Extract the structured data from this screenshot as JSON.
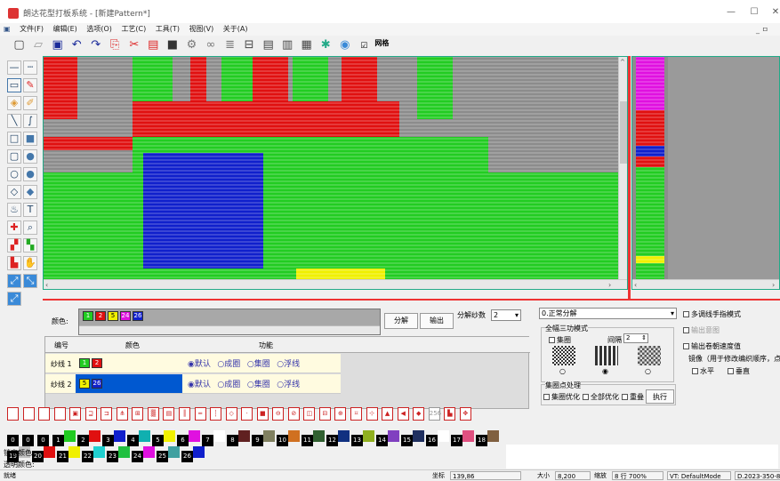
{
  "window": {
    "title": "朗达花型打板系统 - [新建Pattern*]",
    "controls": [
      "—",
      "☐",
      "✕"
    ]
  },
  "menu": {
    "doc_icon": "▣",
    "items": [
      "文件(F)",
      "编辑(E)",
      "选项(O)",
      "工艺(C)",
      "工具(T)",
      "视图(V)",
      "关于(A)"
    ],
    "mdi": "_ ㅁ"
  },
  "toolbar": {
    "grid_label": "网格",
    "icons": [
      "new-file-icon",
      "open-folder-icon",
      "save-icon",
      "undo-icon",
      "redo-icon",
      "copy-icon",
      "cut-icon",
      "paste-icon",
      "fill-icon",
      "gear-icon",
      "layers-icon",
      "stack-icon",
      "frame-icon",
      "list-icon",
      "bars-icon",
      "palette-icon",
      "settings-icon",
      "eye-icon"
    ]
  },
  "colors": {
    "green": "#22cc22",
    "red": "#e01010",
    "blue": "#1020cc",
    "gray": "#8c8c8c",
    "magenta": "#e010e0",
    "yellow": "#f0f000"
  },
  "yarn_panel": {
    "colors_label": "颜色:",
    "swatches": [
      {
        "num": "1",
        "color": "#22cc22"
      },
      {
        "num": "2",
        "color": "#e01010"
      },
      {
        "num": "5",
        "color": "#f0f000"
      },
      {
        "num": "24",
        "color": "#e010e0"
      },
      {
        "num": "26",
        "color": "#1020cc"
      }
    ],
    "split_button": "分解",
    "output_button": "输出",
    "yarn_count_label": "分解纱数",
    "yarn_count_value": "2",
    "table_headers": [
      "编号",
      "颜色",
      "功能"
    ],
    "rows": [
      {
        "label": "纱线 1",
        "colors": [
          "#22cc22",
          "#e01010"
        ],
        "nums": [
          "1",
          "2"
        ]
      },
      {
        "label": "纱线 2",
        "colors": [
          "#f0f000",
          "#1020cc"
        ],
        "nums": [
          "5",
          "26"
        ]
      }
    ],
    "functions": [
      "默认",
      "成圈",
      "集圈",
      "浮线"
    ]
  },
  "options_panel": {
    "mode_select": "0.正常分解",
    "full_tuck_legend": "全幅三功模式",
    "tuck_label": "集圈",
    "gap_label": "间隔",
    "gap_value": "2",
    "multi_finger": "多调线手指模式",
    "output_intent": "输出意图",
    "output_speed": "输出卷朝速度值",
    "mirror_title": "镜像（用于修改编织顺序，点分析",
    "horizontal": "水平",
    "vertical": "垂直",
    "tuck_process_legend": "集圈点处理",
    "tuck_opt": "集圈优化",
    "full_opt": "全部优化",
    "overlap": "重叠",
    "execute": "执行"
  },
  "palette": [
    {
      "num": "0",
      "color": "#000000"
    },
    {
      "num": "0",
      "color": "#000000"
    },
    {
      "num": "0",
      "color": "#000000"
    },
    {
      "num": "1",
      "color": "#22cc22"
    },
    {
      "num": "2",
      "color": "#e01010"
    },
    {
      "num": "3",
      "color": "#1020cc"
    },
    {
      "num": "4",
      "color": "#10b0b0"
    },
    {
      "num": "5",
      "color": "#f0f000"
    },
    {
      "num": "6",
      "color": "#e010e0"
    },
    {
      "num": "7",
      "color": "#ffffff"
    },
    {
      "num": "8",
      "color": "#602020"
    },
    {
      "num": "9",
      "color": "#808060"
    },
    {
      "num": "10",
      "color": "#d07020"
    },
    {
      "num": "11",
      "color": "#306030"
    },
    {
      "num": "12",
      "color": "#103080"
    },
    {
      "num": "13",
      "color": "#90b020"
    },
    {
      "num": "14",
      "color": "#8040c0"
    },
    {
      "num": "15",
      "color": "#203060"
    },
    {
      "num": "16",
      "color": "#ffffff"
    },
    {
      "num": "17",
      "color": "#e05080"
    },
    {
      "num": "18",
      "color": "#806040"
    },
    {
      "num": "19",
      "color": "#c0c0c0"
    },
    {
      "num": "20",
      "color": "#e01010"
    },
    {
      "num": "21",
      "color": "#f0f000"
    },
    {
      "num": "22",
      "color": "#20d0d0"
    },
    {
      "num": "23",
      "color": "#20c040"
    },
    {
      "num": "24",
      "color": "#e010e0"
    },
    {
      "num": "25",
      "color": "#40a0a0"
    },
    {
      "num": "26",
      "color": "#1020cc"
    }
  ],
  "locked_colors_label": "锁定颜色:",
  "transparent_colors_label": "透明颜色:",
  "status": {
    "ready": "就绪",
    "coord_label": "坐标",
    "coord_value": "139,86",
    "size_label": "大小",
    "size_value": "8,200",
    "zoom_label": "缩放",
    "zoom_value": "8 行 700%",
    "vt_mode": "VT: DefaultMode",
    "version": "D.2023-350-8"
  }
}
